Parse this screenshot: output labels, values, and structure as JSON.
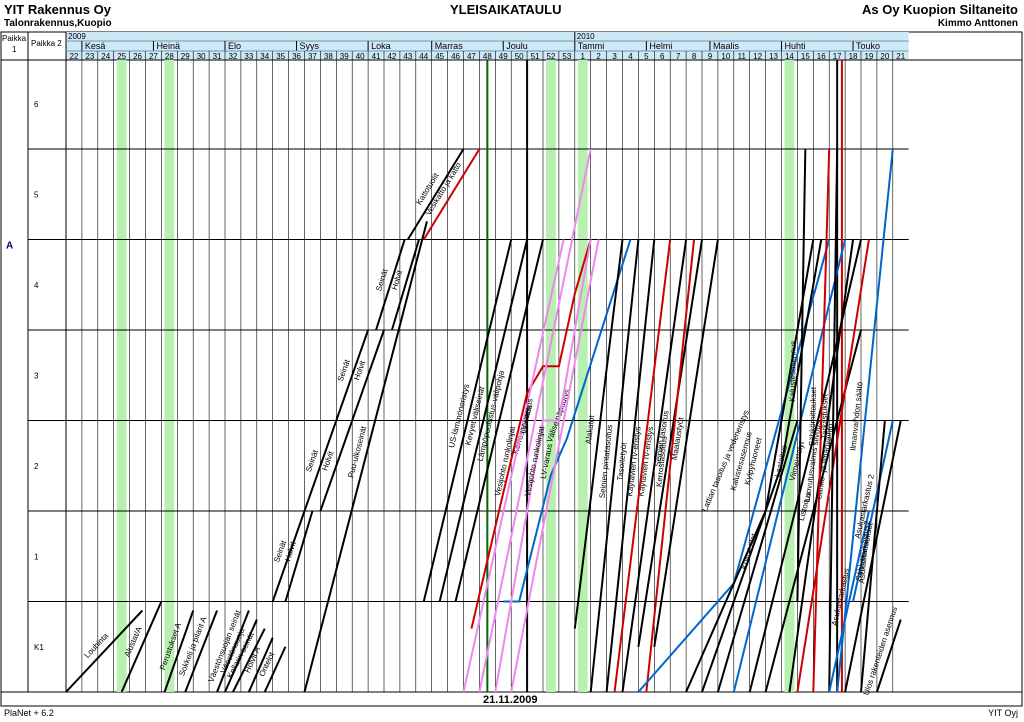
{
  "header": {
    "company": "YIT Rakennus Oy",
    "division": "Talonrakennus,Kuopio",
    "title": "YLEISAIKATAULU",
    "project": "As Oy Kuopion Siltaneito",
    "person": "Kimmo Anttonen"
  },
  "axis": {
    "place1_label": "Paikka 1",
    "place2_label": "Paikka 2",
    "years": [
      {
        "label": "2009",
        "week": 22
      },
      {
        "label": "2010",
        "week": 54
      }
    ],
    "months": [
      {
        "label": "Kesä",
        "week": 23
      },
      {
        "label": "Heinä",
        "week": 27.5
      },
      {
        "label": "Elo",
        "week": 32
      },
      {
        "label": "Syys",
        "week": 36.5
      },
      {
        "label": "Loka",
        "week": 41
      },
      {
        "label": "Marras",
        "week": 45
      },
      {
        "label": "Joulu",
        "week": 49.5
      },
      {
        "label": "Tammi",
        "week": 54
      },
      {
        "label": "Helmi",
        "week": 58.5
      },
      {
        "label": "Maalis",
        "week": 62.5
      },
      {
        "label": "Huhti",
        "week": 67
      },
      {
        "label": "Touko",
        "week": 71.5
      }
    ],
    "weeks": [
      "22",
      "23",
      "24",
      "25",
      "26",
      "27",
      "28",
      "29",
      "30",
      "31",
      "32",
      "33",
      "34",
      "35",
      "36",
      "37",
      "38",
      "39",
      "40",
      "41",
      "42",
      "43",
      "44",
      "45",
      "46",
      "47",
      "48",
      "49",
      "50",
      "51",
      "52",
      "53",
      "1",
      "2",
      "3",
      "4",
      "5",
      "6",
      "7",
      "8",
      "9",
      "10",
      "11",
      "12",
      "13",
      "14",
      "15",
      "16",
      "17",
      "18",
      "19",
      "20",
      "21"
    ],
    "place1": [
      {
        "label": "A",
        "level": 4.9
      }
    ],
    "levels": [
      "K1",
      "1",
      "2",
      "3",
      "4",
      "5",
      "6"
    ],
    "highlight_weeks": [
      25,
      28,
      52,
      54,
      67
    ]
  },
  "chart_data": {
    "type": "line",
    "x_unit": "week (2009 wk 22 – 2010 wk 21)",
    "y_unit": "floor level (K1=0 … 6)",
    "series": [
      {
        "color": "#000000",
        "points": [
          [
            22.0,
            0
          ],
          [
            26.8,
            0.9
          ]
        ],
        "label": "Louhinta"
      },
      {
        "color": "#000000",
        "points": [
          [
            25.5,
            0
          ],
          [
            28,
            1
          ]
        ],
        "label": "Alustat/A"
      },
      {
        "color": "#000000",
        "points": [
          [
            28.2,
            0
          ],
          [
            30,
            0.9
          ]
        ],
        "label": "Perustukset A"
      },
      {
        "color": "#000000",
        "points": [
          [
            29.5,
            0
          ],
          [
            31.5,
            0.9
          ]
        ],
        "label": "Sokkeli ja pilarit A"
      },
      {
        "color": "#000000",
        "points": [
          [
            31.5,
            0
          ],
          [
            33.5,
            0.9
          ]
        ],
        "label": "Väestönsuojan seinät"
      },
      {
        "color": "#000000",
        "points": [
          [
            32,
            0
          ],
          [
            34,
            0.8
          ]
        ],
        "label": "Väestönsuoja"
      },
      {
        "color": "#000000",
        "points": [
          [
            32.5,
            0
          ],
          [
            34.5,
            0.7
          ]
        ],
        "label": "Kellarin seinät"
      },
      {
        "color": "#000000",
        "points": [
          [
            33.5,
            0
          ],
          [
            35,
            0.6
          ]
        ],
        "label": "Holvit A"
      },
      {
        "color": "#000000",
        "points": [
          [
            34.5,
            0
          ],
          [
            35.8,
            0.5
          ]
        ],
        "label": "Ontelot"
      },
      {
        "color": "#000000",
        "points": [
          [
            35,
            1
          ],
          [
            37,
            2
          ]
        ],
        "label": "Seinät"
      },
      {
        "color": "#000000",
        "points": [
          [
            35.8,
            1
          ],
          [
            37.5,
            2
          ]
        ],
        "label": "Holvit"
      },
      {
        "color": "#000000",
        "points": [
          [
            37,
            2
          ],
          [
            39,
            3
          ]
        ],
        "label": "Seinät"
      },
      {
        "color": "#000000",
        "points": [
          [
            38,
            2
          ],
          [
            40,
            3
          ]
        ],
        "label": "Holvit"
      },
      {
        "color": "#000000",
        "points": [
          [
            39,
            3
          ],
          [
            41,
            4
          ]
        ],
        "label": "Seinät"
      },
      {
        "color": "#000000",
        "points": [
          [
            40,
            3
          ],
          [
            42,
            4
          ]
        ],
        "label": "Holvit"
      },
      {
        "color": "#000000",
        "points": [
          [
            41.5,
            4
          ],
          [
            43.3,
            5
          ]
        ],
        "label": "Seinät"
      },
      {
        "color": "#000000",
        "points": [
          [
            42.5,
            4
          ],
          [
            44.2,
            5
          ]
        ],
        "label": "Holvit"
      },
      {
        "color": "#000000",
        "points": [
          [
            37,
            0
          ],
          [
            44.7,
            5.2
          ]
        ],
        "label": "Puu-ulkoseinät"
      },
      {
        "color": "#000000",
        "points": [
          [
            43.5,
            5
          ],
          [
            47,
            6
          ]
        ],
        "label": "Kattotuolit"
      },
      {
        "color": "#cc0000",
        "points": [
          [
            44.5,
            5
          ],
          [
            48,
            6
          ]
        ],
        "label": "Vesikatto ja katto"
      },
      {
        "color": "#000000",
        "points": [
          [
            44.5,
            1
          ],
          [
            50,
            5
          ]
        ],
        "label": "US-lämmöneristys"
      },
      {
        "color": "#000000",
        "points": [
          [
            45.5,
            1
          ],
          [
            51,
            5
          ]
        ],
        "label": "Kevyet väliseinät"
      },
      {
        "color": "#000000",
        "points": [
          [
            46.5,
            1
          ],
          [
            52,
            5
          ]
        ],
        "label": "Lämpöpuolustus-välipohja"
      },
      {
        "color": "#cc0000",
        "points": [
          [
            47.5,
            0.7
          ],
          [
            49.5,
            2.2
          ],
          [
            51,
            3.3
          ],
          [
            52,
            3.6
          ],
          [
            53,
            3.6
          ],
          [
            54,
            4.4
          ],
          [
            55,
            5
          ]
        ],
        "label": "Kerrostasoitus"
      },
      {
        "color": "#0066cc",
        "points": [
          [
            49.5,
            1
          ],
          [
            50.5,
            1
          ],
          [
            52.5,
            2.4
          ],
          [
            53.5,
            2.8
          ],
          [
            57.5,
            5
          ]
        ],
        "label": "Väliseinäpuutys"
      },
      {
        "color": "#ee88ee",
        "points": [
          [
            47,
            0
          ],
          [
            53.3,
            5
          ]
        ],
        "label": "Vesijohto runkolinjat"
      },
      {
        "color": "#ee88ee",
        "points": [
          [
            49,
            0
          ],
          [
            52,
            3
          ],
          [
            53,
            3
          ],
          [
            55,
            5
          ]
        ],
        "label": "Vesijohto runkolinjat"
      },
      {
        "color": "#ee88ee",
        "points": [
          [
            48,
            0
          ],
          [
            55,
            6
          ]
        ],
        "label": "LV-varaus"
      },
      {
        "color": "#ee88ee",
        "points": [
          [
            50,
            0
          ],
          [
            55.5,
            5
          ]
        ],
        "label": "LV-varaus"
      },
      {
        "color": "#000000",
        "points": [
          [
            54,
            0.7
          ],
          [
            57,
            5
          ]
        ],
        "label": "Alakatot"
      },
      {
        "color": "#000000",
        "points": [
          [
            55,
            0
          ],
          [
            58,
            5
          ]
        ],
        "label": "Seinien pintatasoitus"
      },
      {
        "color": "#000000",
        "points": [
          [
            56,
            0
          ],
          [
            59,
            5
          ]
        ],
        "label": "Tasoitetyöt"
      },
      {
        "color": "#000000",
        "points": [
          [
            57,
            0
          ],
          [
            61,
            5
          ]
        ],
        "label": "Käytävien IV-eristys"
      },
      {
        "color": "#000000",
        "points": [
          [
            58,
            0.5
          ],
          [
            62,
            5
          ]
        ],
        "label": "Seinien tasoitus"
      },
      {
        "color": "#000000",
        "points": [
          [
            59,
            0.5
          ],
          [
            63,
            5
          ]
        ],
        "label": "Maalaustyöt"
      },
      {
        "color": "#cc0000",
        "points": [
          [
            56.5,
            0
          ],
          [
            60,
            5
          ]
        ],
        "label": "Käytävien IV-eristys"
      },
      {
        "color": "#cc0000",
        "points": [
          [
            58.5,
            0
          ],
          [
            61.5,
            5
          ]
        ],
        "label": "Kerrostasoitus"
      },
      {
        "color": "#0066cc",
        "points": [
          [
            58,
            0
          ],
          [
            64,
            1.2
          ],
          [
            70,
            5
          ]
        ],
        "label": "Lattian tasoitus ja vedeneristys"
      },
      {
        "color": "#000000",
        "points": [
          [
            61,
            0
          ],
          [
            66,
            2
          ],
          [
            69,
            5
          ]
        ],
        "label": "Kalustesasennus"
      },
      {
        "color": "#000000",
        "points": [
          [
            62,
            0
          ],
          [
            67,
            2.5
          ],
          [
            69.5,
            5
          ]
        ],
        "label": "Kylpyhuoneet"
      },
      {
        "color": "#0066cc",
        "points": [
          [
            64,
            0
          ],
          [
            71,
            5
          ]
        ],
        "label": "Laatoitus"
      },
      {
        "color": "#000000",
        "points": [
          [
            63,
            0
          ],
          [
            68,
            3
          ]
        ],
        "label": "Kuivat tilat"
      },
      {
        "color": "#000000",
        "points": [
          [
            65,
            0
          ],
          [
            70,
            3.5
          ],
          [
            72,
            5
          ]
        ],
        "label": "Viimeistelyt"
      },
      {
        "color": "#000000",
        "points": [
          [
            66,
            0
          ],
          [
            72,
            4
          ]
        ],
        "label": "Listoitus"
      },
      {
        "color": "#000000",
        "points": [
          [
            67.5,
            0
          ],
          [
            71.5,
            5
          ]
        ],
        "label": "Luovutusvalmis siivous"
      },
      {
        "color": "#000000",
        "points": [
          [
            68,
            1
          ],
          [
            68.5,
            6
          ]
        ],
        "label": "Kalustesasennus"
      },
      {
        "color": "#cc0000",
        "points": [
          [
            68,
            0
          ],
          [
            72.5,
            5
          ]
        ],
        "label": "Sähkö- ja ilmanvaihto"
      },
      {
        "color": "#cc0000",
        "points": [
          [
            69,
            0
          ],
          [
            70,
            6
          ]
        ],
        "label": "Sähkömittaukset"
      },
      {
        "color": "#000000",
        "points": [
          [
            70,
            0
          ],
          [
            70.5,
            6
          ]
        ],
        "label": "Tarkastukset"
      },
      {
        "color": "#0066cc",
        "points": [
          [
            70,
            0
          ],
          [
            72.5,
            2
          ]
        ],
        "label": "Asukastarkastus"
      },
      {
        "color": "#0066cc",
        "points": [
          [
            71.5,
            1
          ],
          [
            74,
            3
          ]
        ],
        "label": "Asukastarkastus 2"
      },
      {
        "color": "#000000",
        "points": [
          [
            72,
            0
          ],
          [
            73.5,
            3
          ]
        ],
        "label": "Asukastarkastus2"
      },
      {
        "color": "#000000",
        "points": [
          [
            71,
            0
          ],
          [
            74.5,
            3
          ]
        ],
        "label": "Sähkömittaukset"
      },
      {
        "color": "#0066cc",
        "points": [
          [
            70.5,
            0
          ],
          [
            74,
            6
          ]
        ],
        "label": "Ilmanvaihdon säätö"
      },
      {
        "color": "#000000",
        "points": [
          [
            73,
            0
          ],
          [
            74.5,
            0.8
          ]
        ],
        "label": "Ulos rakenteiden asennus"
      }
    ],
    "vertical_markers": [
      {
        "week": 48.5,
        "color": "#006600"
      },
      {
        "week": 51,
        "color": "#000000"
      },
      {
        "week": 70.5,
        "color": "#000000"
      },
      {
        "week": 70.8,
        "color": "#cc0000"
      }
    ]
  },
  "footer": {
    "left": "PlaNet + 6.2",
    "date": "21.11.2009",
    "right": "YIT Oyj"
  }
}
